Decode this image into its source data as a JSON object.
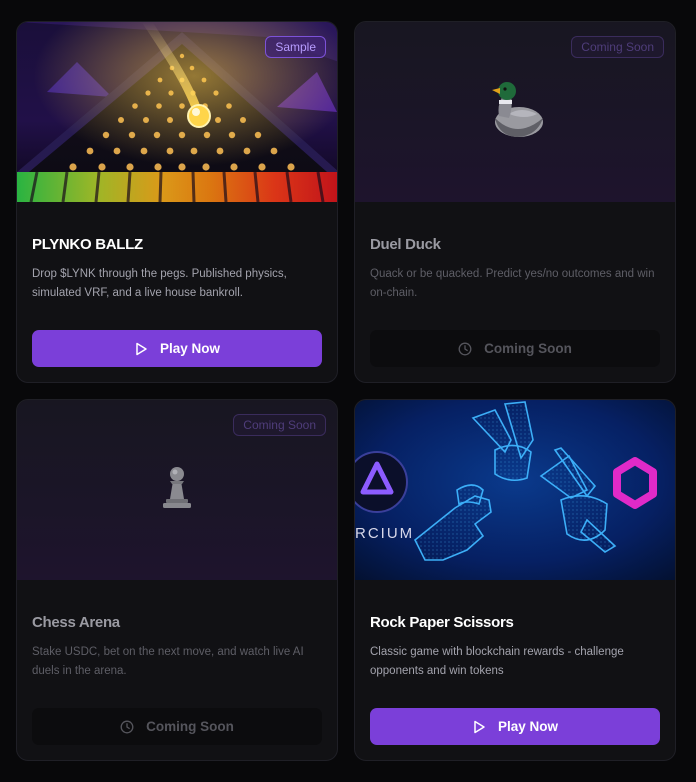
{
  "games": [
    {
      "title": "PLYNKO BALLZ",
      "badge": "Sample",
      "description": "Drop $LYNK through the pegs. Published physics, simulated VRF, and a live house bankroll.",
      "button_label": "Play Now",
      "button_icon": "play-icon",
      "status": "available"
    },
    {
      "title": "Duel Duck",
      "badge": "Coming Soon",
      "description": "Quack or be quacked. Predict yes/no outcomes and win on-chain.",
      "button_label": "Coming Soon",
      "button_icon": "clock-icon",
      "icon": "duck-icon",
      "status": "coming-soon"
    },
    {
      "title": "Chess Arena",
      "badge": "Coming Soon",
      "description": "Stake USDC, bet on the next move, and watch live AI duels in the arena.",
      "button_label": "Coming Soon",
      "button_icon": "clock-icon",
      "icon": "pawn-icon",
      "status": "coming-soon"
    },
    {
      "title": "Rock Paper Scissors",
      "description": "Classic game with blockchain rewards - challenge opponents and win tokens",
      "button_label": "Play Now",
      "button_icon": "play-icon",
      "image_text": "RCIUM",
      "status": "available"
    }
  ],
  "colors": {
    "accent": "#7b3fd9",
    "background": "#08080a",
    "card": "#111114"
  }
}
